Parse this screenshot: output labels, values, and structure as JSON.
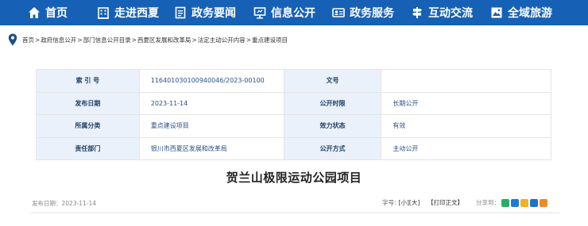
{
  "nav": {
    "items": [
      {
        "label": "首页",
        "icon": "home-icon"
      },
      {
        "label": "走进西夏",
        "icon": "building-icon"
      },
      {
        "label": "政务要闻",
        "icon": "document-icon"
      },
      {
        "label": "信息公开",
        "icon": "monitor-icon"
      },
      {
        "label": "政务服务",
        "icon": "id-card-icon"
      },
      {
        "label": "互动交流",
        "icon": "signpost-icon"
      },
      {
        "label": "全域旅游",
        "icon": "landscape-icon"
      }
    ]
  },
  "breadcrumb": {
    "items": [
      "首页",
      "政府信息公开",
      "部门信息公开目录",
      "西夏区发展和改革局",
      "法定主动公开内容",
      "重点建设项目"
    ],
    "separator": ">"
  },
  "info": {
    "index_label": "索 引 号",
    "index_value": "116401030100940046/2023-00100",
    "docno_label": "文号",
    "docno_value": "",
    "pubdate_label": "发布日期",
    "pubdate_value": "2023-11-14",
    "period_label": "公开时限",
    "period_value": "长期公开",
    "category_label": "所属分类",
    "category_value": "重点建设项目",
    "validity_label": "效力状态",
    "validity_value": "有效",
    "dept_label": "责任部门",
    "dept_value": "银川市西夏区发展和改革局",
    "method_label": "公开方式",
    "method_value": "主动公开"
  },
  "article": {
    "title": "贺兰山极限运动公园项目",
    "date_text": "发布日期：2023-11-14",
    "fontsize_label": "字号:",
    "font_small": "[小]",
    "font_large": "[大]",
    "print_label": "【打印正文】",
    "share_label": "分享到："
  },
  "colors": {
    "nav_bg": "#1661b6",
    "label_bg": "#eaf1fb",
    "share_wechat": "#2aae67",
    "share_weibo": "#1e7bd6",
    "share_qzone": "#f3b21b",
    "share_renren": "#1d73c9",
    "share_more": "#f08a24"
  }
}
